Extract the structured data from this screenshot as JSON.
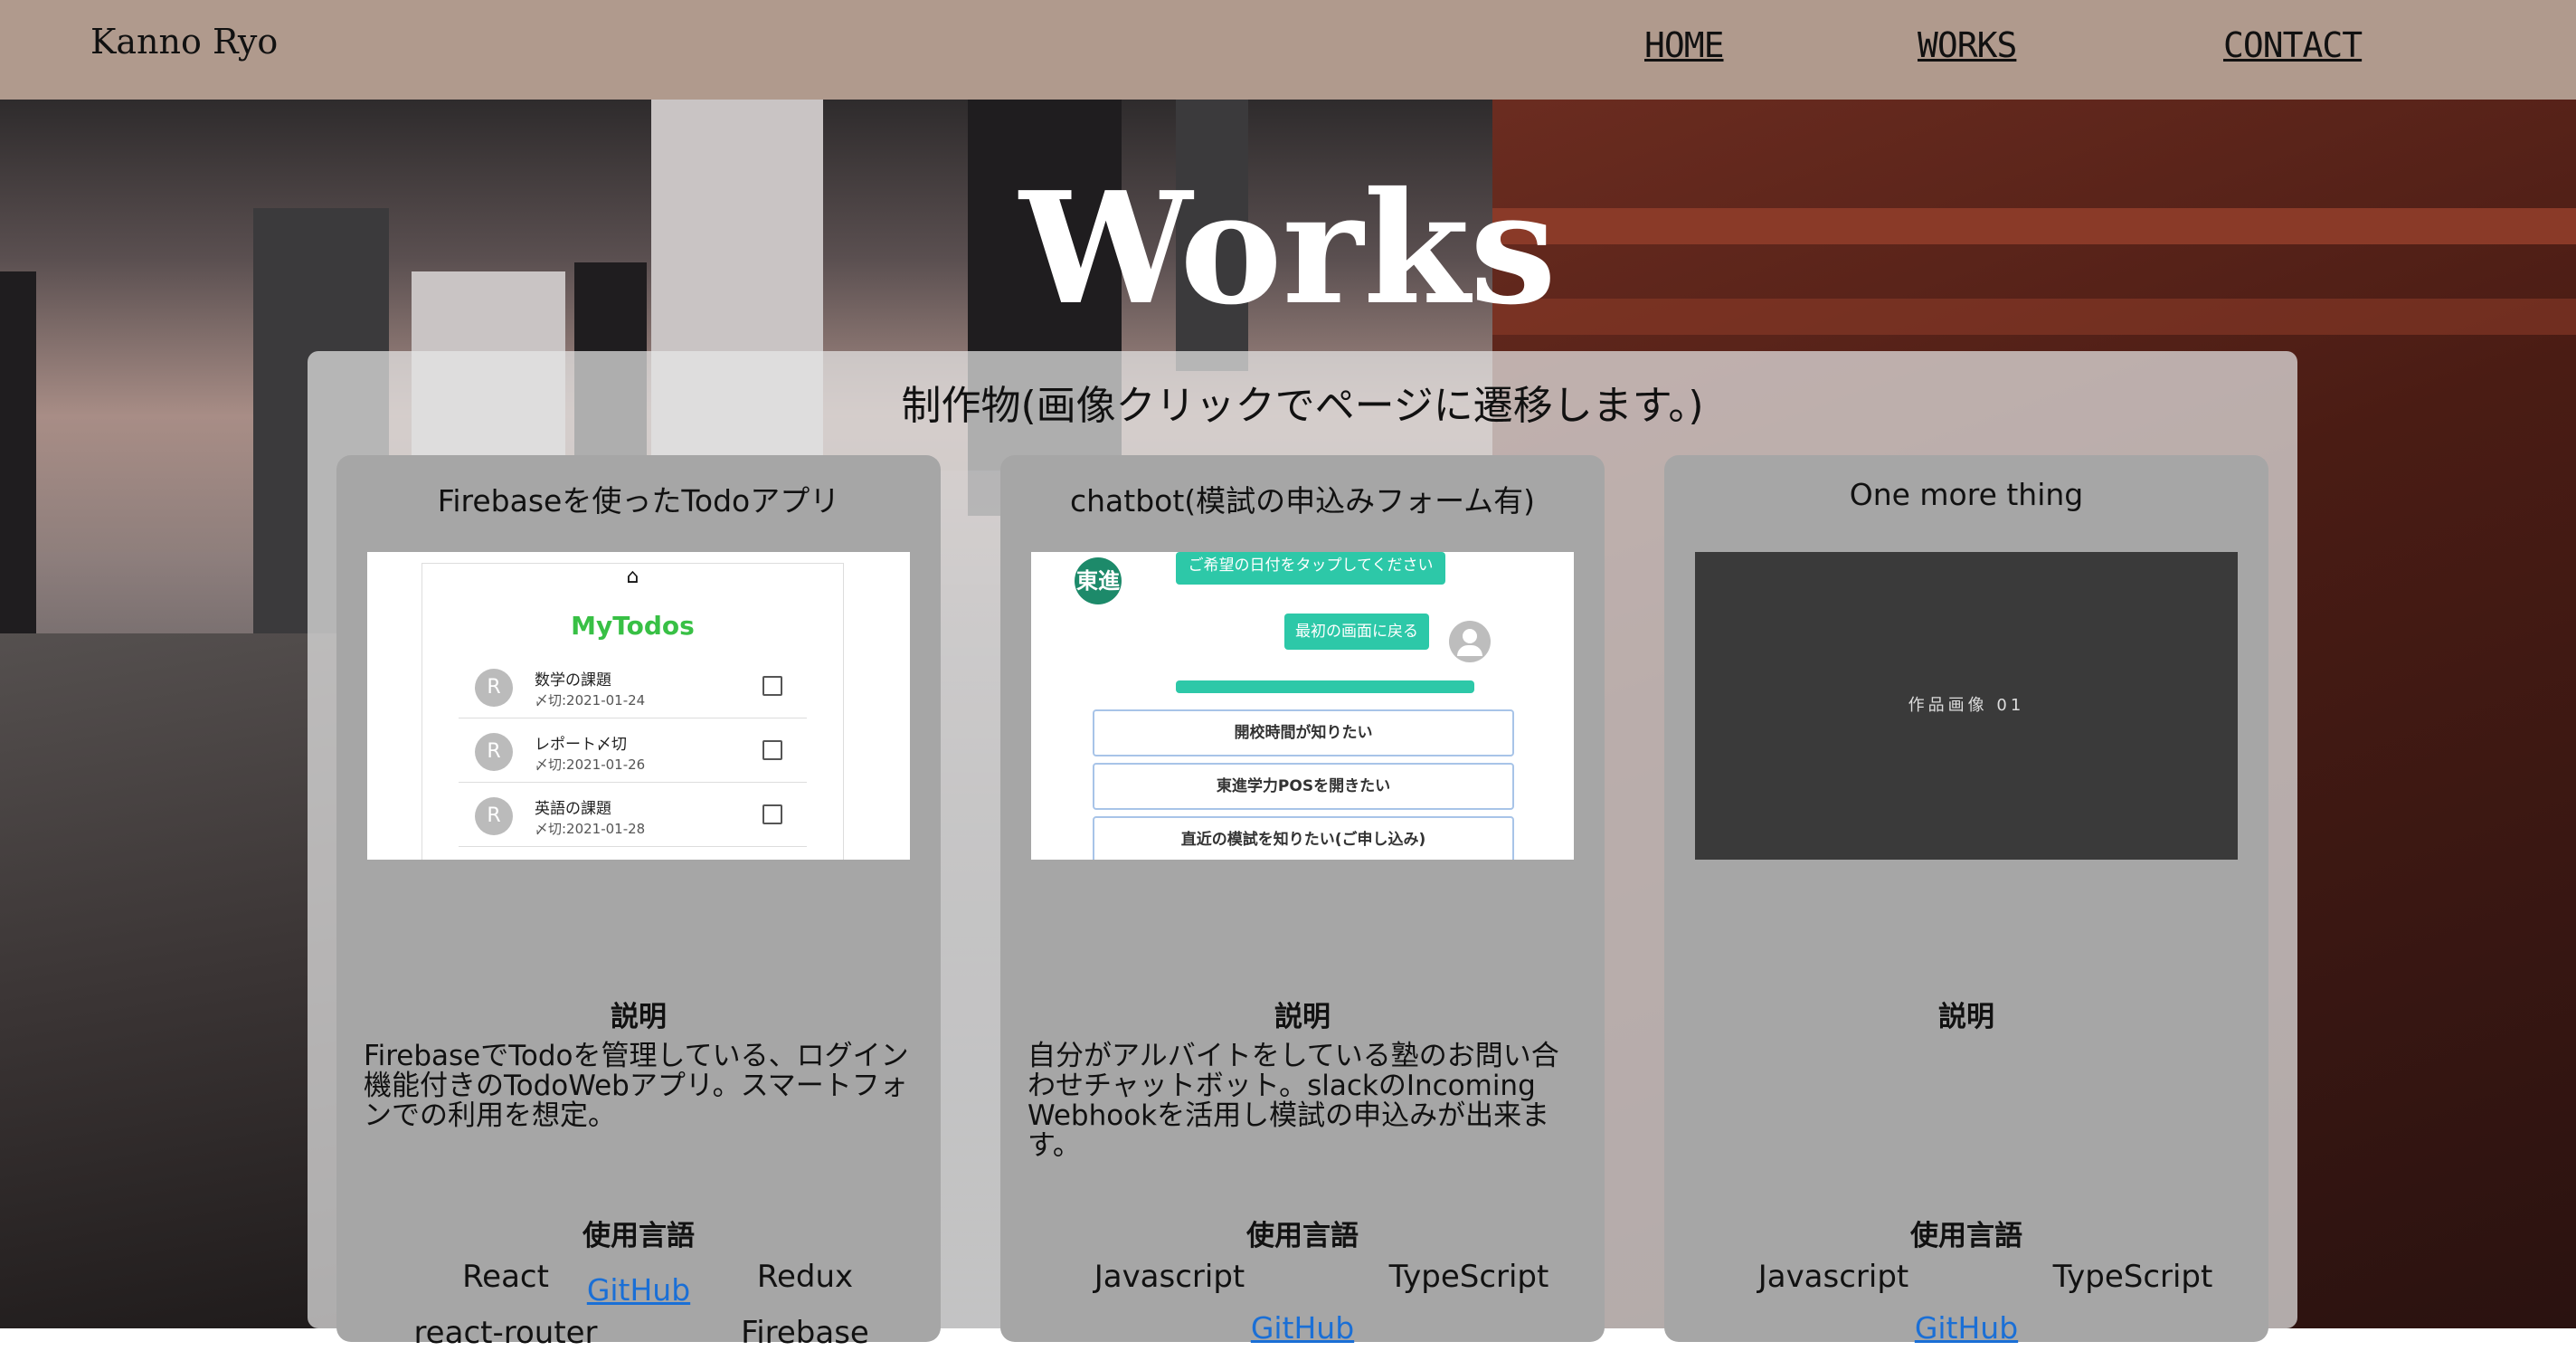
{
  "header": {
    "logo": "Kanno Ryo",
    "nav": [
      "HOME",
      "WORKS",
      "CONTACT"
    ]
  },
  "page_title": "Works",
  "panel_heading": "制作物(画像クリックでページに遷移します。)",
  "cards": [
    {
      "title": "Firebaseを使ったTodoアプリ",
      "thumb": {
        "app_title": "MyTodos",
        "items": [
          {
            "avatar": "R",
            "name": "数学の課題",
            "date": "〆切:2021-01-24"
          },
          {
            "avatar": "R",
            "name": "レポート〆切",
            "date": "〆切:2021-01-26"
          },
          {
            "avatar": "R",
            "name": "英語の課題",
            "date": "〆切:2021-01-28"
          }
        ]
      },
      "desc_label": "説明",
      "description": "FirebaseでTodoを管理している、ログイン機能付きのTodoWebアプリ。スマートフォンでの利用を想定。",
      "lang_label": "使用言語",
      "languages": [
        "React",
        "Redux",
        "react-router",
        "Firebase"
      ],
      "github": "GitHub"
    },
    {
      "title": "chatbot(模試の申込みフォーム有)",
      "thumb": {
        "logo": "東進",
        "bubble_top": "ご希望の日付をタップしてください",
        "bubble_back": "最初の画面に戻る",
        "buttons": [
          "開校時間が知りたい",
          "東進学力POSを開きたい",
          "直近の模試を知りたい(ご申し込み)"
        ]
      },
      "desc_label": "説明",
      "description": "自分がアルバイトをしている塾のお問い合わせチャットボット。slackのIncoming Webhookを活用し模試の申込みが出来ます。",
      "lang_label": "使用言語",
      "languages": [
        "Javascript",
        "TypeScript"
      ],
      "github": "GitHub"
    },
    {
      "title": "One more thing",
      "thumb": {
        "placeholder": "作品画像 01"
      },
      "desc_label": "説明",
      "description": "",
      "lang_label": "使用言語",
      "languages": [
        "Javascript",
        "TypeScript"
      ],
      "github": "GitHub"
    }
  ],
  "colors": {
    "header_bg": "#b09a8d",
    "card_bg": "#a6a6a6",
    "link": "#1a6fd6",
    "todo_title": "#38c045",
    "chat_accent": "#2dc8a8"
  },
  "icons": [
    "home-icon",
    "avatar-icon",
    "checkbox-icon",
    "user-icon"
  ]
}
